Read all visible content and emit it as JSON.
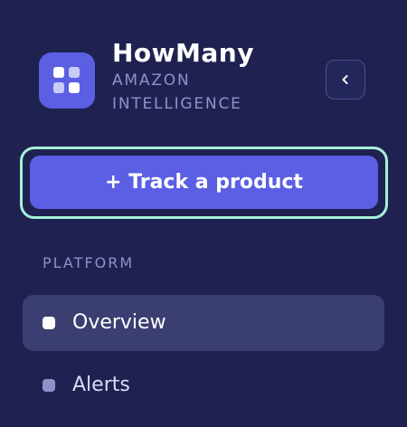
{
  "brand": {
    "name": "HowMany",
    "subtitle": "AMAZON INTELLIGENCE",
    "logo_icon": "grid-icon"
  },
  "collapse": {
    "icon": "chevron-left-icon"
  },
  "primary_action": {
    "label": "+ Track a product"
  },
  "sidebar": {
    "section_label": "PLATFORM",
    "items": [
      {
        "label": "Overview",
        "active": true
      },
      {
        "label": "Alerts",
        "active": false
      }
    ]
  },
  "colors": {
    "background": "#1f2251",
    "accent": "#5a5fe3",
    "focus_ring": "#a6f0d7",
    "active_item_bg": "#3b3e70",
    "muted_text": "#8d92c9"
  }
}
